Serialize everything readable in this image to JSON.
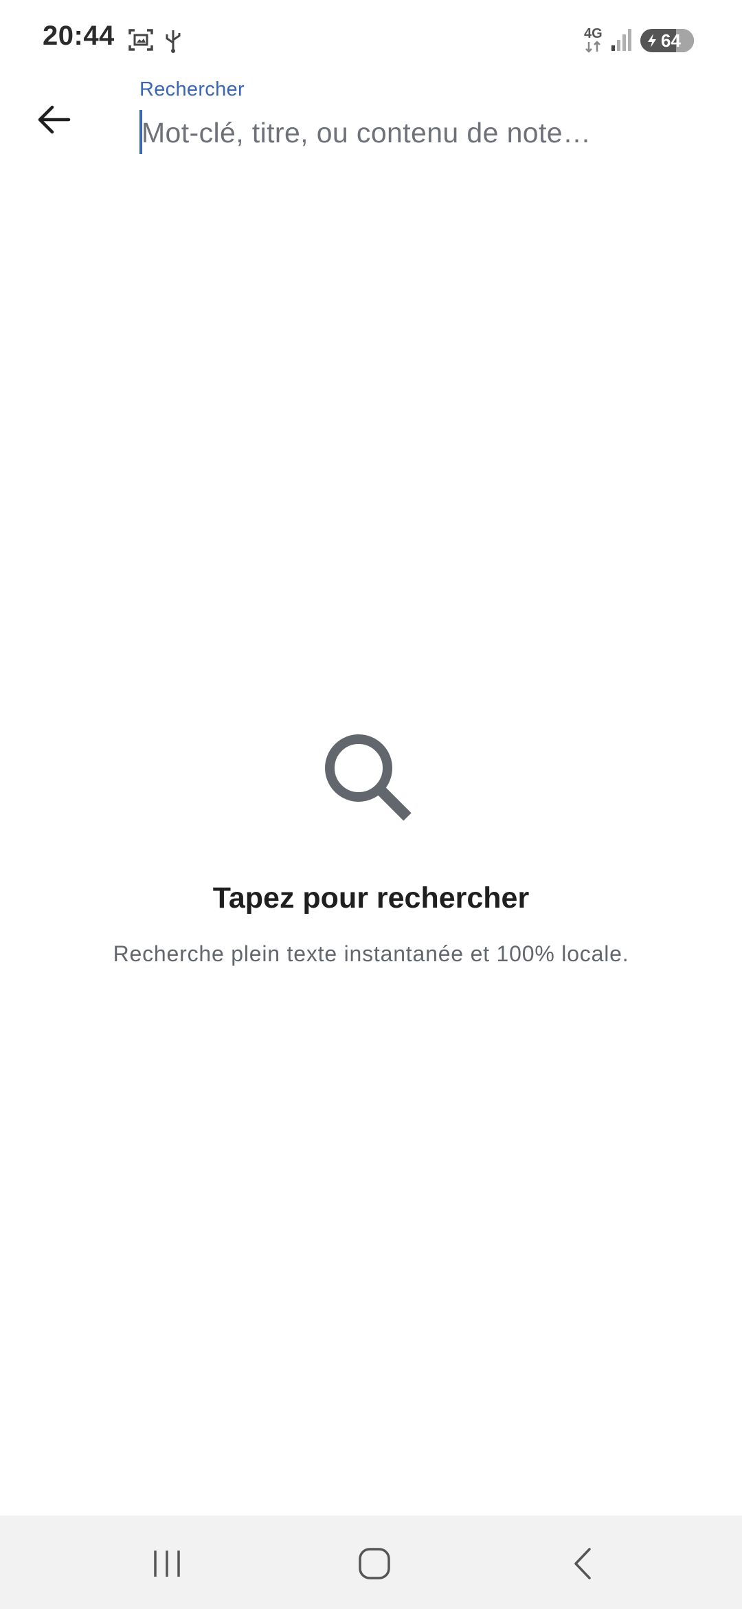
{
  "status_bar": {
    "time": "20:44",
    "network": "4G",
    "battery_level": "64",
    "icons": [
      "screenshot-icon",
      "usb-icon",
      "network-4g-icon",
      "signal-icon",
      "battery-charging-icon"
    ]
  },
  "header": {
    "back_icon": "arrow-left-icon",
    "search_label": "Rechercher",
    "search_placeholder": "Mot-clé, titre, ou contenu de note…",
    "search_value": ""
  },
  "empty_state": {
    "icon": "search-icon",
    "title": "Tapez pour rechercher",
    "subtitle": "Recherche plein texte instantanée et 100% locale."
  },
  "nav_bar": {
    "buttons": [
      "recent-apps-icon",
      "home-icon",
      "back-icon"
    ]
  },
  "colors": {
    "accent": "#3a66b8",
    "icon_gray": "#62666d",
    "title": "#1f1f1f",
    "nav_background": "#f2f2f2"
  }
}
